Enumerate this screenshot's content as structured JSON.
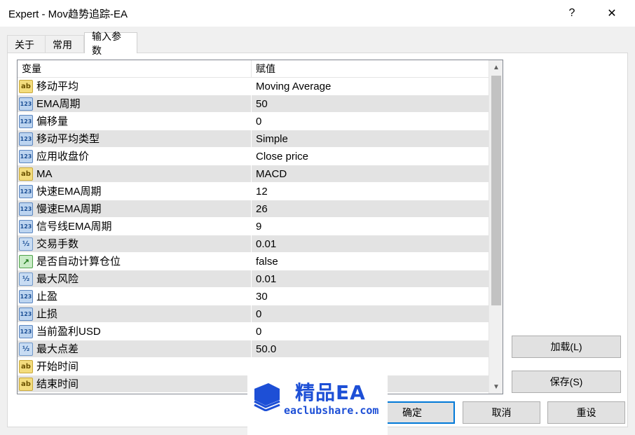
{
  "window": {
    "title": "Expert - Mov趋势追踪-EA",
    "help_label": "?",
    "close_label": "✕"
  },
  "tabs": [
    {
      "label": "关于"
    },
    {
      "label": "常用"
    },
    {
      "label": "输入参数"
    }
  ],
  "grid": {
    "col_variable": "变量",
    "col_value": "赋值",
    "rows": [
      {
        "type": "str",
        "icon_text": "ab",
        "name": "移动平均",
        "value": "Moving Average"
      },
      {
        "type": "int",
        "icon_text": "123",
        "name": "EMA周期",
        "value": "50"
      },
      {
        "type": "int",
        "icon_text": "123",
        "name": "偏移量",
        "value": "0"
      },
      {
        "type": "int",
        "icon_text": "123",
        "name": "移动平均类型",
        "value": "Simple"
      },
      {
        "type": "int",
        "icon_text": "123",
        "name": "应用收盘价",
        "value": "Close price"
      },
      {
        "type": "str",
        "icon_text": "ab",
        "name": "MA",
        "value": "MACD"
      },
      {
        "type": "int",
        "icon_text": "123",
        "name": "快速EMA周期",
        "value": "12"
      },
      {
        "type": "int",
        "icon_text": "123",
        "name": "慢速EMA周期",
        "value": "26"
      },
      {
        "type": "int",
        "icon_text": "123",
        "name": "信号线EMA周期",
        "value": "9"
      },
      {
        "type": "dbl",
        "icon_text": "½",
        "name": "交易手数",
        "value": "0.01"
      },
      {
        "type": "bool",
        "icon_text": "↗",
        "name": "是否自动计算仓位",
        "value": "false"
      },
      {
        "type": "dbl",
        "icon_text": "½",
        "name": "最大风险",
        "value": "0.01"
      },
      {
        "type": "int",
        "icon_text": "123",
        "name": "止盈",
        "value": "30"
      },
      {
        "type": "int",
        "icon_text": "123",
        "name": "止损",
        "value": "0"
      },
      {
        "type": "int",
        "icon_text": "123",
        "name": "当前盈利USD",
        "value": "0"
      },
      {
        "type": "dbl",
        "icon_text": "½",
        "name": "最大点差",
        "value": "50.0"
      },
      {
        "type": "str",
        "icon_text": "ab",
        "name": "开始时间",
        "value": ""
      },
      {
        "type": "str",
        "icon_text": "ab",
        "name": "结束时间",
        "value": ""
      }
    ]
  },
  "buttons": {
    "load": "加载(L)",
    "save": "保存(S)",
    "ok": "确定",
    "cancel": "取消",
    "reset": "重设"
  },
  "watermark": {
    "brand": "精品EA",
    "url": "eaclubshare.com",
    "color": "#1d4fd6"
  },
  "colors": {
    "accent": "#0078d7",
    "row_alt": "#e3e3e3"
  }
}
